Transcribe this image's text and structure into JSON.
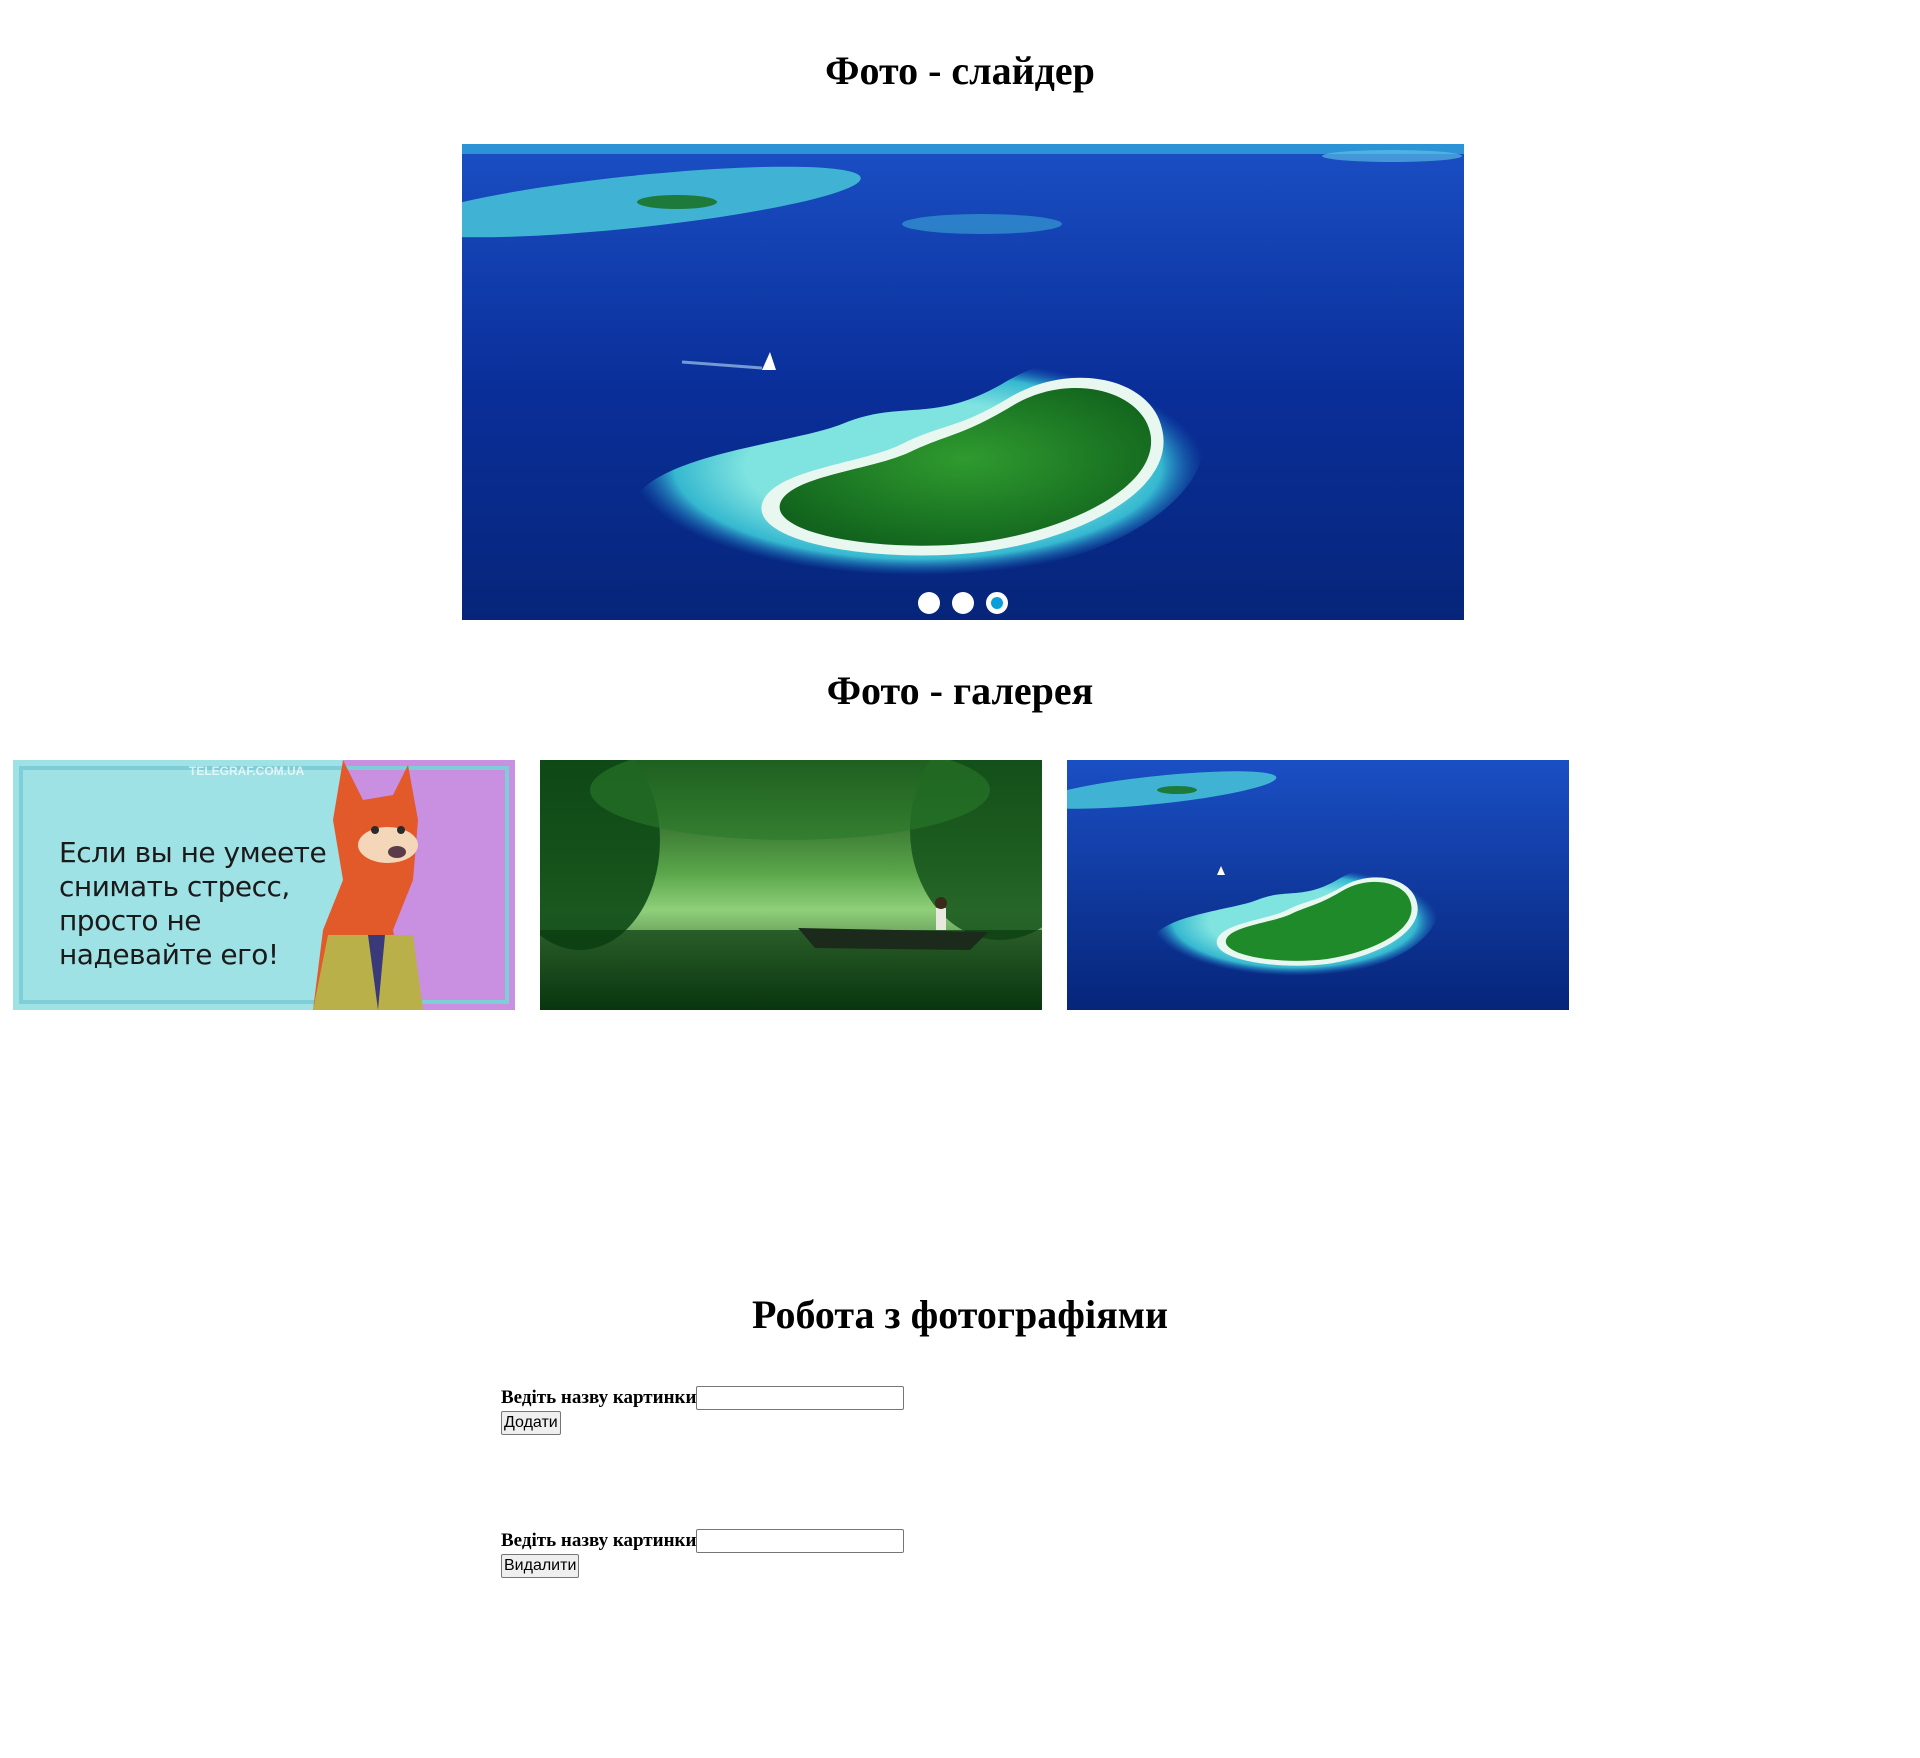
{
  "slider": {
    "title": "Фото - слайдер",
    "image_subject": "heart-shaped-island",
    "dots": [
      {
        "active": false
      },
      {
        "active": false
      },
      {
        "active": true
      }
    ]
  },
  "gallery": {
    "title": "Фото - галерея",
    "items": [
      {
        "subject": "fox-meme",
        "caption": "Если вы не умеете снимать стресс, просто не надевайте его!",
        "watermark": "TELEGRAF.COM.UA"
      },
      {
        "subject": "forest-lake-boat"
      },
      {
        "subject": "heart-shaped-island"
      }
    ]
  },
  "work": {
    "title": "Робота з фотографіями",
    "add_form": {
      "label": "Ведіть назву картинки",
      "value": "",
      "button": "Додати"
    },
    "delete_form": {
      "label": "Ведіть назву картинки",
      "value": "",
      "button": "Видалити"
    }
  },
  "colors": {
    "ocean": "#0a2a8c",
    "lagoon": "#3cc9d6",
    "island_green": "#1f8a2a",
    "active_dot": "#0a9fd8"
  }
}
